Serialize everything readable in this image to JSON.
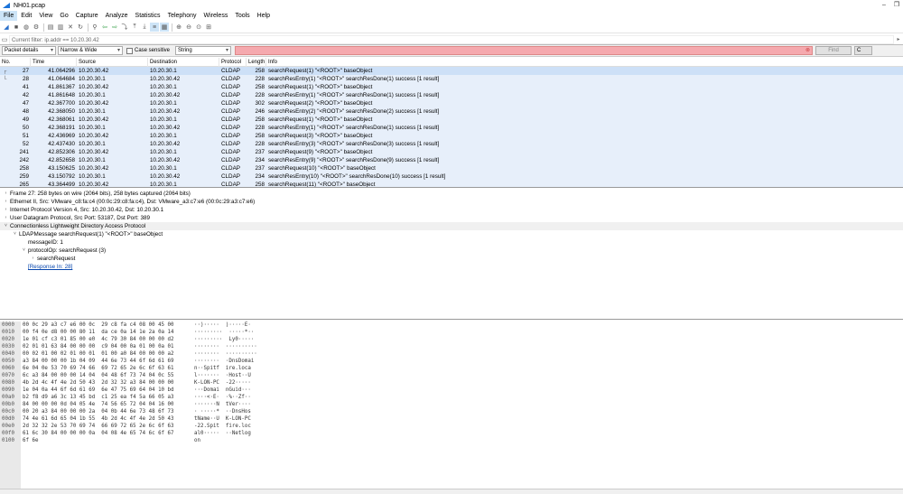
{
  "window": {
    "title": "NH01.pcap",
    "controls": [
      "–",
      "❐"
    ]
  },
  "menu": [
    "File",
    "Edit",
    "View",
    "Go",
    "Capture",
    "Analyze",
    "Statistics",
    "Telephony",
    "Wireless",
    "Tools",
    "Help"
  ],
  "filter": {
    "text": "Current filter: ip.addr == 10.20.30.42"
  },
  "find": {
    "scope": "Packet details",
    "char_width": "Narrow & Wide",
    "case_label": "Case sensitive",
    "type": "String",
    "find_label": "Find",
    "cancel_label": "C"
  },
  "packet_list": {
    "headers": [
      "No.",
      "Time",
      "Source",
      "Destination",
      "Protocol",
      "Length",
      "Info"
    ],
    "rows": [
      [
        "27",
        "41.064296",
        "10.20.30.42",
        "10.20.30.1",
        "CLDAP",
        "258",
        "searchRequest(1) \"<ROOT>\" baseObject"
      ],
      [
        "28",
        "41.064684",
        "10.20.30.1",
        "10.20.30.42",
        "CLDAP",
        "228",
        "searchResEntry(1) \"<ROOT>\" searchResDone(1) success  [1 result]"
      ],
      [
        "41",
        "41.861367",
        "10.20.30.42",
        "10.20.30.1",
        "CLDAP",
        "258",
        "searchRequest(1) \"<ROOT>\" baseObject"
      ],
      [
        "42",
        "41.861648",
        "10.20.30.1",
        "10.20.30.42",
        "CLDAP",
        "228",
        "searchResEntry(1) \"<ROOT>\" searchResDone(1) success  [1 result]"
      ],
      [
        "47",
        "42.367700",
        "10.20.30.42",
        "10.20.30.1",
        "CLDAP",
        "302",
        "searchRequest(2) \"<ROOT>\" baseObject"
      ],
      [
        "48",
        "42.368050",
        "10.20.30.1",
        "10.20.30.42",
        "CLDAP",
        "246",
        "searchResEntry(2) \"<ROOT>\" searchResDone(2) success  [1 result]"
      ],
      [
        "49",
        "42.368061",
        "10.20.30.42",
        "10.20.30.1",
        "CLDAP",
        "258",
        "searchRequest(1) \"<ROOT>\" baseObject"
      ],
      [
        "50",
        "42.368191",
        "10.20.30.1",
        "10.20.30.42",
        "CLDAP",
        "228",
        "searchResEntry(1) \"<ROOT>\" searchResDone(1) success  [1 result]"
      ],
      [
        "51",
        "42.436969",
        "10.20.30.42",
        "10.20.30.1",
        "CLDAP",
        "258",
        "searchRequest(3) \"<ROOT>\" baseObject"
      ],
      [
        "52",
        "42.437430",
        "10.20.30.1",
        "10.20.30.42",
        "CLDAP",
        "228",
        "searchResEntry(3) \"<ROOT>\" searchResDone(3) success  [1 result]"
      ],
      [
        "241",
        "42.852306",
        "10.20.30.42",
        "10.20.30.1",
        "CLDAP",
        "237",
        "searchRequest(9) \"<ROOT>\" baseObject"
      ],
      [
        "242",
        "42.852658",
        "10.20.30.1",
        "10.20.30.42",
        "CLDAP",
        "234",
        "searchResEntry(9) \"<ROOT>\" searchResDone(9) success  [1 result]"
      ],
      [
        "258",
        "43.150625",
        "10.20.30.42",
        "10.20.30.1",
        "CLDAP",
        "237",
        "searchRequest(10) \"<ROOT>\" baseObject"
      ],
      [
        "259",
        "43.150792",
        "10.20.30.1",
        "10.20.30.42",
        "CLDAP",
        "234",
        "searchResEntry(10) \"<ROOT>\" searchResDone(10) success  [1 result]"
      ],
      [
        "265",
        "43.364499",
        "10.20.30.42",
        "10.20.30.1",
        "CLDAP",
        "258",
        "searchRequest(11) \"<ROOT>\" baseObject"
      ]
    ]
  },
  "details": [
    {
      "indent": 0,
      "caret": "›",
      "text": "Frame 27: 258 bytes on wire (2064 bits), 258 bytes captured (2064 bits)",
      "section": false
    },
    {
      "indent": 0,
      "caret": "›",
      "text": "Ethernet II, Src: VMware_c8:fa:c4 (00:0c:29:c8:fa:c4), Dst: VMware_a3:c7:e6 (00:0c:29:a3:c7:e6)",
      "section": false
    },
    {
      "indent": 0,
      "caret": "›",
      "text": "Internet Protocol Version 4, Src: 10.20.30.42, Dst: 10.20.30.1",
      "section": false
    },
    {
      "indent": 0,
      "caret": "›",
      "text": "User Datagram Protocol, Src Port: 53187, Dst Port: 389",
      "section": false
    },
    {
      "indent": 0,
      "caret": "˅",
      "text": "Connectionless Lightweight Directory Access Protocol",
      "section": true
    },
    {
      "indent": 1,
      "caret": "˅",
      "text": "LDAPMessage searchRequest(1) \"<ROOT>\" baseObject",
      "section": false
    },
    {
      "indent": 2,
      "caret": "",
      "text": "messageID: 1",
      "section": false
    },
    {
      "indent": 2,
      "caret": "˅",
      "text": "protocolOp: searchRequest (3)",
      "section": false
    },
    {
      "indent": 3,
      "caret": "›",
      "text": "searchRequest",
      "section": false
    },
    {
      "indent": 2,
      "caret": "",
      "text": "[Response In: 28]",
      "section": false,
      "link": true
    }
  ],
  "bytes": {
    "offsets": [
      "0000",
      "0010",
      "0020",
      "0030",
      "0040",
      "0050",
      "0060",
      "0070",
      "0080",
      "0090",
      "00a0",
      "00b0",
      "00c0",
      "00d0",
      "00e0",
      "00f0",
      "0100"
    ],
    "hex": [
      "00 0c 29 a3 c7 e6 00 0c  29 c8 fa c4 08 00 45 00",
      "00 f4 0e d8 00 00 80 11  da ce 0a 14 1e 2a 0a 14",
      "1e 01 cf c3 01 85 00 e0  4c 79 30 84 00 00 00 d2",
      "02 01 01 63 84 00 00 00  c9 04 00 0a 01 00 0a 01",
      "00 02 01 00 02 01 00 01  01 00 a0 84 00 00 00 a2",
      "a3 84 00 00 00 1b 04 09  44 6e 73 44 6f 6d 61 69",
      "6e 04 0e 53 70 69 74 66  69 72 65 2e 6c 6f 63 61",
      "6c a3 84 00 00 00 14 04  04 48 6f 73 74 04 0c 55",
      "4b 2d 4c 4f 4e 2d 50 43  2d 32 32 a3 84 00 00 00",
      "1e 04 0a 44 6f 6d 61 69  6e 47 75 69 64 04 10 bd",
      "b2 f8 d9 a6 3c 13 45 bd  c1 25 ea f4 5a 66 05 a3",
      "84 00 00 00 0d 04 05 4e  74 56 65 72 04 04 16 00",
      "00 20 a3 84 00 00 00 2a  04 0b 44 6e 73 48 6f 73",
      "74 4e 61 6d 65 04 1b 55  4b 2d 4c 4f 4e 2d 50 43",
      "2d 32 32 2e 53 70 69 74  66 69 72 65 2e 6c 6f 63",
      "61 6c 30 84 00 00 00 0a  04 08 4e 65 74 6c 6f 67",
      "6f 6e"
    ],
    "ascii": [
      "··)·····  )·····E·",
      "·········  ·····*··",
      "·········  Ly0·····",
      "········  ··········",
      "········  ··········",
      "········  ·DnsDomai",
      "n··Spitf  ire.loca",
      "l·······  ·Host··U",
      "K-LON-PC  -22·····",
      "···Domai  nGuid···",
      "····<·E·  ·%··Zf··",
      "·······N  tVer····",
      "· ·····*  ··DnsHos",
      "tName··U  K-LON-PC",
      "-22.Spit  fire.loc",
      "al0·····  ··Netlog",
      "on"
    ]
  },
  "colors": {
    "row_bg": "#e7effa",
    "selected_row_bg": "#cde0f7",
    "find_bg": "#f5a9ae"
  }
}
